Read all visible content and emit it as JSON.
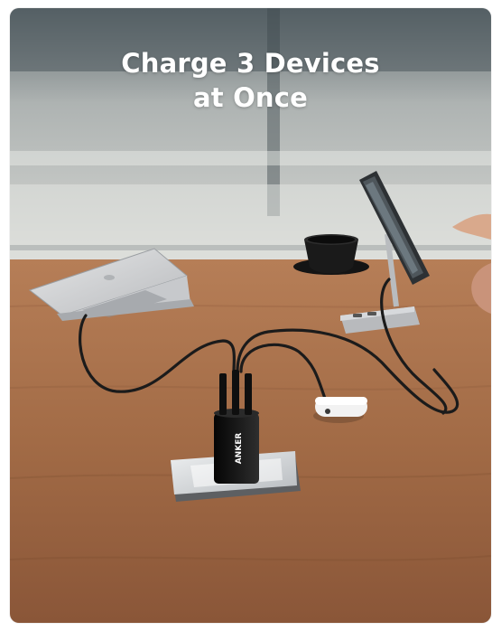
{
  "headline": {
    "line1": "Charge 3 Devices",
    "line2": "at Once"
  },
  "product": {
    "brand_mark": "ANKER"
  },
  "scene": {
    "devices": [
      "laptop-icon",
      "tablet-stand-icon",
      "earbuds-case-icon"
    ],
    "charger": "charger-icon",
    "colors": {
      "table": "#a36b47",
      "background": "#c9ccc9",
      "charger": "#141414"
    }
  }
}
